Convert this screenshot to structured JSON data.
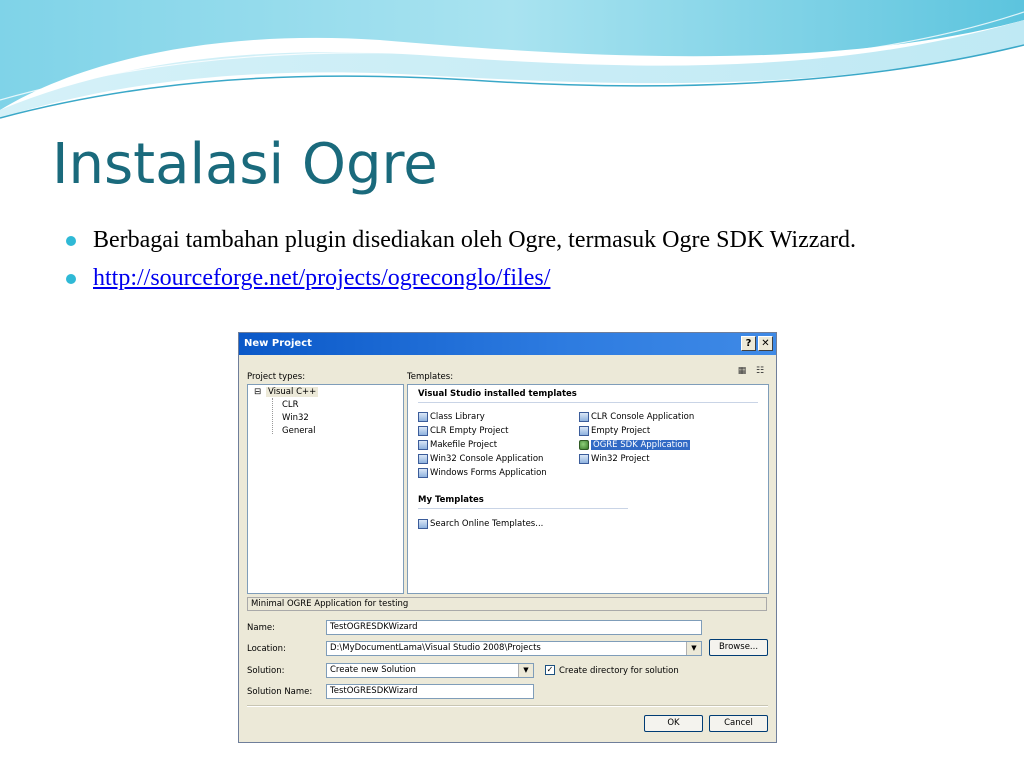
{
  "slide": {
    "title": "Instalasi Ogre",
    "bullets": [
      "Berbagai tambahan plugin disediakan oleh Ogre, termasuk Ogre SDK Wizzard.",
      "http://sourceforge.net/projects/ogreconglo/files/"
    ]
  },
  "dialog": {
    "title": "New Project",
    "help_label": "?",
    "close_label": "✕",
    "project_types_label": "Project types:",
    "templates_label": "Templates:",
    "tree": {
      "root": "Visual C++",
      "children": [
        "CLR",
        "Win32",
        "General"
      ]
    },
    "installed_header": "Visual Studio installed templates",
    "templates_left": [
      "Class Library",
      "CLR Empty Project",
      "Makefile Project",
      "Win32 Console Application",
      "Windows Forms Application"
    ],
    "templates_right": [
      "CLR Console Application",
      "Empty Project",
      "OGRE SDK Application",
      "Win32 Project"
    ],
    "selected_template": "OGRE SDK Application",
    "my_templates_header": "My Templates",
    "search_online": "Search Online Templates...",
    "description": "Minimal OGRE Application for testing",
    "name_label": "Name:",
    "name_value": "TestOGRESDKWizard",
    "location_label": "Location:",
    "location_value": "D:\\MyDocumentLama\\Visual Studio 2008\\Projects",
    "solution_label": "Solution:",
    "solution_value": "Create new Solution",
    "create_dir_label": "Create directory for solution",
    "create_dir_checked": true,
    "solution_name_label": "Solution Name:",
    "solution_name_value": "TestOGRESDKWizard",
    "browse_label": "Browse...",
    "ok_label": "OK",
    "cancel_label": "Cancel"
  }
}
